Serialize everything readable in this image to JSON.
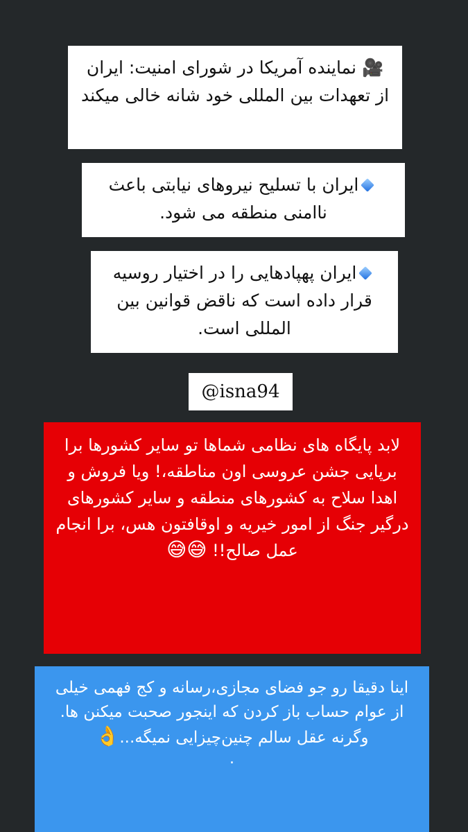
{
  "headline": {
    "icon": "🎥",
    "text": "نماینده آمریکا در شورای امنیت: ایران از تعهدات بین المللی خود شانه خالی میکند"
  },
  "points": [
    {
      "icon": "blue-diamond-icon",
      "text": "ایران با تسلیح نیروهای نیابتی باعث ناامنی منطقه می شود."
    },
    {
      "icon": "blue-diamond-icon",
      "text": "ایران پهپادهایی را در اختیار روسیه قرار داده است که ناقض قوانین بین المللی است."
    }
  ],
  "handle": "@isna94",
  "red_comment": {
    "text": "لابد پایگاه های نظامی شماها تو سایر کشورها برا برپایی جشن عروسی اون مناطقه،! ویا  فروش و اهدا سلاح به کشورهای منطقه و سایر کشورهای درگیر جنگ  از امور خیریه و اوقافتون هس، برا انجام عمل صالح!!",
    "emoji": "😅😅",
    "color": "#e60005"
  },
  "blue_comment": {
    "text": "اینا دقیقا رو جو فضای مجازی،رسانه و کج فهمی خیلی از عوام حساب باز کردن  که اینجور صحبت میکنن ها. وگرنه عقل سالم چنین‌چیزایی نمیگه...",
    "emoji": "👌",
    "dot": ".",
    "color": "#3b96ee"
  },
  "background_color": "#24282a"
}
